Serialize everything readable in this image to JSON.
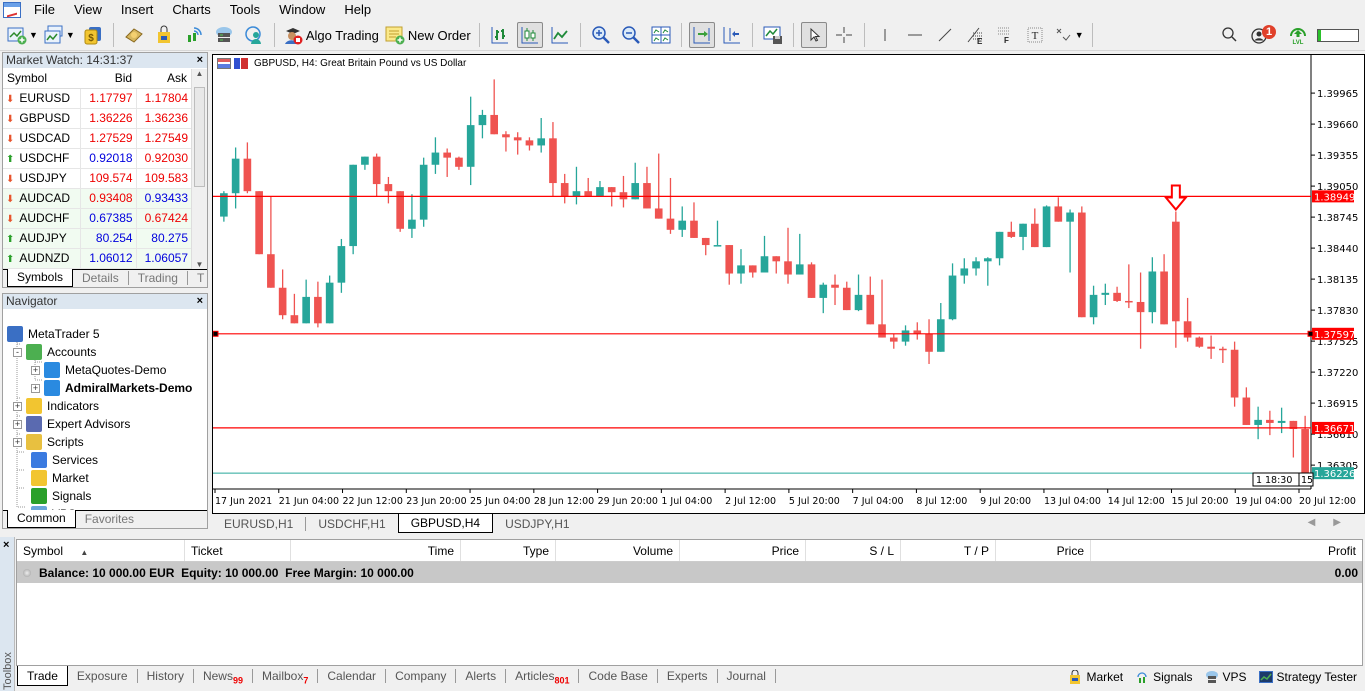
{
  "menu": [
    "File",
    "View",
    "Insert",
    "Charts",
    "Tools",
    "Window",
    "Help"
  ],
  "toolbar": {
    "algo_trading": "Algo Trading",
    "new_order": "New Order",
    "notification_count": "1"
  },
  "market_watch": {
    "title": "Market Watch: 14:31:37",
    "columns": [
      "Symbol",
      "Bid",
      "Ask"
    ],
    "rows": [
      {
        "symbol": "EURUSD",
        "dir": "down",
        "bid": "1.17797",
        "ask": "1.17804",
        "bid_color": "red",
        "ask_color": "red"
      },
      {
        "symbol": "GBPUSD",
        "dir": "down",
        "bid": "1.36226",
        "ask": "1.36236",
        "bid_color": "red",
        "ask_color": "red"
      },
      {
        "symbol": "USDCAD",
        "dir": "down",
        "bid": "1.27529",
        "ask": "1.27549",
        "bid_color": "red",
        "ask_color": "red"
      },
      {
        "symbol": "USDCHF",
        "dir": "up",
        "bid": "0.92018",
        "ask": "0.92030",
        "bid_color": "blue",
        "ask_color": "red"
      },
      {
        "symbol": "USDJPY",
        "dir": "down",
        "bid": "109.574",
        "ask": "109.583",
        "bid_color": "red",
        "ask_color": "red"
      },
      {
        "symbol": "AUDCAD",
        "dir": "down",
        "bid": "0.93408",
        "ask": "0.93433",
        "bid_color": "red",
        "ask_color": "blue"
      },
      {
        "symbol": "AUDCHF",
        "dir": "down",
        "bid": "0.67385",
        "ask": "0.67424",
        "bid_color": "blue",
        "ask_color": "red"
      },
      {
        "symbol": "AUDJPY",
        "dir": "up",
        "bid": "80.254",
        "ask": "80.275",
        "bid_color": "blue",
        "ask_color": "blue"
      },
      {
        "symbol": "AUDNZD",
        "dir": "up",
        "bid": "1.06012",
        "ask": "1.06057",
        "bid_color": "blue",
        "ask_color": "blue"
      }
    ],
    "tabs": [
      "Symbols",
      "Details",
      "Trading",
      "T"
    ]
  },
  "navigator": {
    "title": "Navigator",
    "items": [
      {
        "label": "MetaTrader 5",
        "level": 0,
        "expander": "",
        "bold": false,
        "icon": "metatrader-icon"
      },
      {
        "label": "Accounts",
        "level": 1,
        "expander": "-",
        "bold": false,
        "icon": "accounts-icon"
      },
      {
        "label": "MetaQuotes-Demo",
        "level": 2,
        "expander": "+",
        "bold": false,
        "icon": "server-icon"
      },
      {
        "label": "AdmiralMarkets-Demo",
        "level": 2,
        "expander": "+",
        "bold": true,
        "icon": "server-icon"
      },
      {
        "label": "Indicators",
        "level": 1,
        "expander": "+",
        "bold": false,
        "icon": "indicators-icon"
      },
      {
        "label": "Expert Advisors",
        "level": 1,
        "expander": "+",
        "bold": false,
        "icon": "expert-advisors-icon"
      },
      {
        "label": "Scripts",
        "level": 1,
        "expander": "+",
        "bold": false,
        "icon": "scripts-icon"
      },
      {
        "label": "Services",
        "level": 1,
        "expander": "",
        "bold": false,
        "icon": "services-icon"
      },
      {
        "label": "Market",
        "level": 1,
        "expander": "",
        "bold": false,
        "icon": "market-icon"
      },
      {
        "label": "Signals",
        "level": 1,
        "expander": "",
        "bold": false,
        "icon": "signals-icon"
      },
      {
        "label": "VPS",
        "level": 1,
        "expander": "",
        "bold": false,
        "icon": "vps-icon"
      }
    ],
    "tabs": [
      "Common",
      "Favorites"
    ]
  },
  "chart": {
    "title": "GBPUSD, H4:  Great Britain Pound vs US Dollar",
    "tabs": [
      "EURUSD,H1",
      "USDCHF,H1",
      "GBPUSD,H4",
      "USDJPY,H1"
    ],
    "active_tab": 2,
    "time_marker": "18:30",
    "time_marker_prefix": "1",
    "time_marker_suffix": "15"
  },
  "chart_data": {
    "type": "candlestick",
    "title": "GBPUSD, H4:  Great Britain Pound vs US Dollar",
    "symbol": "GBPUSD",
    "timeframe": "H4",
    "ylim": [
      1.3607,
      1.4033
    ],
    "y_ticks": [
      "1.39965",
      "1.39660",
      "1.39355",
      "1.39050",
      "1.38745",
      "1.38440",
      "1.38135",
      "1.37830",
      "1.37525",
      "1.37220",
      "1.36915",
      "1.36610",
      "1.36305"
    ],
    "x_ticks": [
      "17 Jun 2021",
      "21 Jun 04:00",
      "22 Jun 12:00",
      "23 Jun 20:00",
      "25 Jun 04:00",
      "28 Jun 12:00",
      "29 Jun 20:00",
      "1 Jul 04:00",
      "2 Jul 12:00",
      "5 Jul 20:00",
      "7 Jul 04:00",
      "8 Jul 12:00",
      "9 Jul 20:00",
      "13 Jul 04:00",
      "14 Jul 12:00",
      "15 Jul 20:00",
      "19 Jul 04:00",
      "20 Jul 12:00"
    ],
    "horizontal_lines": [
      {
        "price": 1.38949,
        "label": "1.38949",
        "color": "#ff0000"
      },
      {
        "price": 1.37597,
        "label": "1.37597",
        "color": "#ff0000"
      },
      {
        "price": 1.36671,
        "label": "1.36671",
        "color": "#ff0000"
      }
    ],
    "bid_line": {
      "price": 1.36226,
      "label": "1.36226",
      "color": "#26a69a"
    },
    "arrow_marker": {
      "candle_index": 81,
      "direction": "down",
      "color": "#ff0000"
    },
    "colors": {
      "bull": "#26a69a",
      "bear": "#ef5350"
    },
    "candles": [
      [
        1.3875,
        1.39,
        1.387,
        1.3898
      ],
      [
        1.3898,
        1.3943,
        1.3883,
        1.3932
      ],
      [
        1.3932,
        1.3948,
        1.3898,
        1.39
      ],
      [
        1.39,
        1.39,
        1.384,
        1.3838
      ],
      [
        1.3838,
        1.3895,
        1.381,
        1.3805
      ],
      [
        1.3805,
        1.3823,
        1.3774,
        1.3778
      ],
      [
        1.3778,
        1.3799,
        1.3771,
        1.377
      ],
      [
        1.377,
        1.3813,
        1.3771,
        1.3796
      ],
      [
        1.3796,
        1.3811,
        1.3766,
        1.377
      ],
      [
        1.377,
        1.3817,
        1.3771,
        1.381
      ],
      [
        1.381,
        1.3853,
        1.38,
        1.3846
      ],
      [
        1.3846,
        1.3915,
        1.3838,
        1.3926
      ],
      [
        1.3926,
        1.3933,
        1.3921,
        1.3934
      ],
      [
        1.3934,
        1.3937,
        1.3895,
        1.3907
      ],
      [
        1.3907,
        1.3914,
        1.3888,
        1.39
      ],
      [
        1.39,
        1.39,
        1.386,
        1.3863
      ],
      [
        1.3863,
        1.3897,
        1.3854,
        1.3872
      ],
      [
        1.3872,
        1.3933,
        1.3865,
        1.3926
      ],
      [
        1.3926,
        1.3953,
        1.3917,
        1.3938
      ],
      [
        1.3938,
        1.3942,
        1.3914,
        1.3933
      ],
      [
        1.3933,
        1.3934,
        1.3921,
        1.3924
      ],
      [
        1.3924,
        1.3993,
        1.3906,
        1.3965
      ],
      [
        1.3965,
        1.398,
        1.3952,
        1.3975
      ],
      [
        1.3975,
        1.401,
        1.3958,
        1.3956
      ],
      [
        1.3956,
        1.3959,
        1.3939,
        1.3953
      ],
      [
        1.3953,
        1.3958,
        1.3936,
        1.395
      ],
      [
        1.395,
        1.3953,
        1.394,
        1.3945
      ],
      [
        1.3945,
        1.3972,
        1.3938,
        1.3952
      ],
      [
        1.3952,
        1.3968,
        1.3895,
        1.3908
      ],
      [
        1.3908,
        1.3917,
        1.3888,
        1.3895
      ],
      [
        1.3895,
        1.3924,
        1.3887,
        1.39
      ],
      [
        1.39,
        1.3913,
        1.3896,
        1.3895
      ],
      [
        1.3895,
        1.391,
        1.3895,
        1.3904
      ],
      [
        1.3904,
        1.3904,
        1.3885,
        1.3899
      ],
      [
        1.3899,
        1.3915,
        1.3884,
        1.3892
      ],
      [
        1.3892,
        1.3928,
        1.3895,
        1.3908
      ],
      [
        1.3908,
        1.3924,
        1.3883,
        1.3883
      ],
      [
        1.3883,
        1.3937,
        1.388,
        1.3873
      ],
      [
        1.3873,
        1.3913,
        1.3858,
        1.3862
      ],
      [
        1.3862,
        1.3885,
        1.3855,
        1.3871
      ],
      [
        1.3871,
        1.3889,
        1.3859,
        1.3854
      ],
      [
        1.3854,
        1.3848,
        1.3837,
        1.3847
      ],
      [
        1.3847,
        1.3871,
        1.3847,
        1.3847
      ],
      [
        1.3847,
        1.3834,
        1.3808,
        1.3819
      ],
      [
        1.3819,
        1.3843,
        1.3809,
        1.3827
      ],
      [
        1.3827,
        1.3821,
        1.3815,
        1.382
      ],
      [
        1.382,
        1.3856,
        1.3822,
        1.3836
      ],
      [
        1.3836,
        1.3836,
        1.3819,
        1.3831
      ],
      [
        1.3831,
        1.3864,
        1.3809,
        1.3818
      ],
      [
        1.3818,
        1.3858,
        1.3818,
        1.3828
      ],
      [
        1.3828,
        1.383,
        1.3795,
        1.3795
      ],
      [
        1.3795,
        1.381,
        1.378,
        1.3808
      ],
      [
        1.3808,
        1.3818,
        1.3788,
        1.3805
      ],
      [
        1.3805,
        1.3811,
        1.3786,
        1.3783
      ],
      [
        1.3783,
        1.3818,
        1.3782,
        1.3798
      ],
      [
        1.3798,
        1.3816,
        1.3769,
        1.3769
      ],
      [
        1.3769,
        1.3813,
        1.3758,
        1.3756
      ],
      [
        1.3756,
        1.376,
        1.3745,
        1.3752
      ],
      [
        1.3752,
        1.3768,
        1.3748,
        1.3763
      ],
      [
        1.3763,
        1.3771,
        1.3754,
        1.376
      ],
      [
        1.376,
        1.3774,
        1.373,
        1.3742
      ],
      [
        1.3742,
        1.379,
        1.3742,
        1.3774
      ],
      [
        1.3774,
        1.3829,
        1.3773,
        1.3817
      ],
      [
        1.3817,
        1.3834,
        1.3809,
        1.3824
      ],
      [
        1.3824,
        1.3835,
        1.3817,
        1.3831
      ],
      [
        1.3831,
        1.3835,
        1.3807,
        1.3834
      ],
      [
        1.3834,
        1.3859,
        1.3827,
        1.386
      ],
      [
        1.386,
        1.387,
        1.3854,
        1.3855
      ],
      [
        1.3855,
        1.3866,
        1.3842,
        1.3868
      ],
      [
        1.3868,
        1.3883,
        1.3856,
        1.3845
      ],
      [
        1.3845,
        1.3886,
        1.3859,
        1.3885
      ],
      [
        1.3885,
        1.3894,
        1.3873,
        1.387
      ],
      [
        1.387,
        1.3882,
        1.382,
        1.3879
      ],
      [
        1.3879,
        1.3885,
        1.3823,
        1.3776
      ],
      [
        1.3776,
        1.3807,
        1.3769,
        1.3798
      ],
      [
        1.3798,
        1.3809,
        1.3788,
        1.38
      ],
      [
        1.38,
        1.3806,
        1.3791,
        1.3792
      ],
      [
        1.3792,
        1.3828,
        1.3785,
        1.3791
      ],
      [
        1.3791,
        1.382,
        1.3745,
        1.3781
      ],
      [
        1.3781,
        1.3835,
        1.377,
        1.3821
      ],
      [
        1.3821,
        1.3838,
        1.3773,
        1.3769
      ],
      [
        1.387,
        1.388,
        1.3746,
        1.3772
      ],
      [
        1.3772,
        1.3795,
        1.3752,
        1.3756
      ],
      [
        1.3756,
        1.3757,
        1.3746,
        1.3747
      ],
      [
        1.3747,
        1.3758,
        1.3735,
        1.3745
      ],
      [
        1.3745,
        1.3747,
        1.3731,
        1.3744
      ],
      [
        1.3744,
        1.3752,
        1.3688,
        1.3697
      ],
      [
        1.3697,
        1.3707,
        1.3674,
        1.367
      ],
      [
        1.367,
        1.3688,
        1.3656,
        1.3675
      ],
      [
        1.3675,
        1.3684,
        1.366,
        1.3672
      ],
      [
        1.3672,
        1.3687,
        1.3662,
        1.3674
      ],
      [
        1.3674,
        1.3674,
        1.3638,
        1.3666
      ],
      [
        1.3666,
        1.3679,
        1.3619,
        1.36226
      ]
    ]
  },
  "toolbox": {
    "label": "Toolbox",
    "columns": [
      "Symbol",
      "Ticket",
      "Time",
      "Type",
      "Volume",
      "Price",
      "S / L",
      "T / P",
      "Price",
      "Profit"
    ],
    "balance_line": "Balance: 10 000.00 EUR  Equity: 10 000.00  Free Margin: 10 000.00",
    "profit": "0.00",
    "tabs": [
      {
        "label": "Trade",
        "badge": ""
      },
      {
        "label": "Exposure",
        "badge": ""
      },
      {
        "label": "History",
        "badge": ""
      },
      {
        "label": "News",
        "badge": "99"
      },
      {
        "label": "Mailbox",
        "badge": "7"
      },
      {
        "label": "Calendar",
        "badge": ""
      },
      {
        "label": "Company",
        "badge": ""
      },
      {
        "label": "Alerts",
        "badge": ""
      },
      {
        "label": "Articles",
        "badge": "801"
      },
      {
        "label": "Code Base",
        "badge": ""
      },
      {
        "label": "Experts",
        "badge": ""
      },
      {
        "label": "Journal",
        "badge": ""
      }
    ],
    "right_buttons": [
      "Market",
      "Signals",
      "VPS",
      "Strategy Tester"
    ]
  }
}
